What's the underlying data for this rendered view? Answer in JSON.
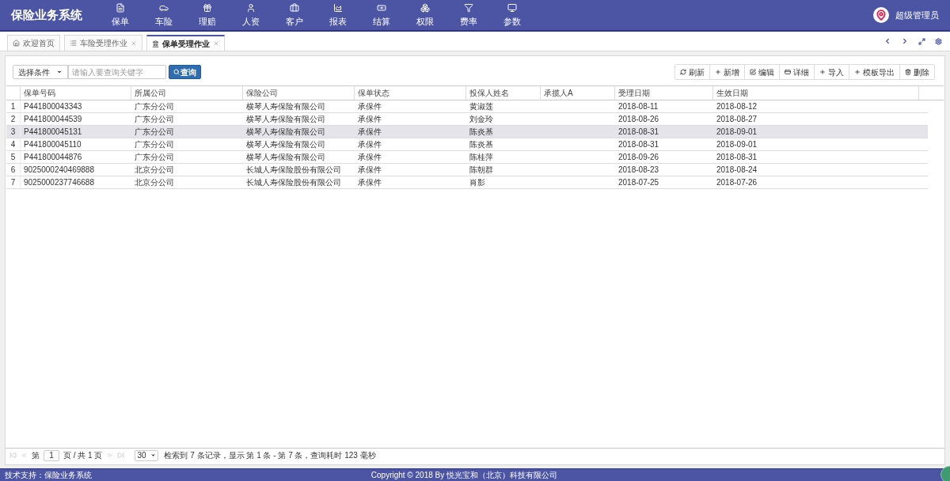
{
  "app_title": "保险业务系统",
  "nav": [
    {
      "label": "保单"
    },
    {
      "label": "车险"
    },
    {
      "label": "理赔"
    },
    {
      "label": "人资"
    },
    {
      "label": "客户"
    },
    {
      "label": "报表"
    },
    {
      "label": "结算"
    },
    {
      "label": "权限"
    },
    {
      "label": "费率"
    },
    {
      "label": "参数"
    }
  ],
  "user": {
    "name": "超级管理员"
  },
  "tabs": [
    {
      "label": "欢迎首页",
      "closable": false,
      "selected": false
    },
    {
      "label": "车险受理作业",
      "closable": true,
      "selected": false
    },
    {
      "label": "保单受理作业",
      "closable": true,
      "selected": true
    }
  ],
  "search": {
    "condition": "选择条件",
    "placeholder": "请输入要查询关键字",
    "button": "查询"
  },
  "actions": [
    {
      "label": "刷新"
    },
    {
      "label": "新增"
    },
    {
      "label": "编辑"
    },
    {
      "label": "详细"
    },
    {
      "label": "导入"
    },
    {
      "label": "模板导出"
    },
    {
      "label": "删除"
    }
  ],
  "table": {
    "columns": [
      "保单号码",
      "所属公司",
      "保险公司",
      "保单状态",
      "投保人姓名",
      "承揽人A",
      "受理日期",
      "生效日期"
    ],
    "rows": [
      {
        "index": "1",
        "cells": [
          "P441800043343",
          "广东分公司",
          "横琴人寿保险有限公司",
          "承保件",
          "黄淑莲",
          "",
          "2018-08-11",
          "2018-08-12"
        ],
        "selected": false
      },
      {
        "index": "2",
        "cells": [
          "P441800044539",
          "广东分公司",
          "横琴人寿保险有限公司",
          "承保件",
          "刘金玲",
          "",
          "2018-08-26",
          "2018-08-27"
        ],
        "selected": false
      },
      {
        "index": "3",
        "cells": [
          "P441800045131",
          "广东分公司",
          "横琴人寿保险有限公司",
          "承保件",
          "陈炎基",
          "",
          "2018-08-31",
          "2018-09-01"
        ],
        "selected": true
      },
      {
        "index": "4",
        "cells": [
          "P441800045110",
          "广东分公司",
          "横琴人寿保险有限公司",
          "承保件",
          "陈炎基",
          "",
          "2018-08-31",
          "2018-09-01"
        ],
        "selected": false
      },
      {
        "index": "5",
        "cells": [
          "P441800044876",
          "广东分公司",
          "横琴人寿保险有限公司",
          "承保件",
          "陈桂萍",
          "",
          "2018-09-26",
          "2018-08-31"
        ],
        "selected": false
      },
      {
        "index": "6",
        "cells": [
          "9025000240469888",
          "北京分公司",
          "长城人寿保险股份有限公司",
          "承保件",
          "陈朝群",
          "",
          "2018-08-23",
          "2018-08-24"
        ],
        "selected": false
      },
      {
        "index": "7",
        "cells": [
          "9025000237746688",
          "北京分公司",
          "长城人寿保险股份有限公司",
          "承保件",
          "肖影",
          "",
          "2018-07-25",
          "2018-07-26"
        ],
        "selected": false
      }
    ]
  },
  "pager": {
    "page_label": "第",
    "page": "1",
    "total": "页 / 共 1 页",
    "page_size": "30",
    "info": "检索到 7 条记录，显示 第 1 条 - 第 7 条，查询耗时 123 毫秒"
  },
  "footer": {
    "left": "技术支持：保险业务系统",
    "right": "Copyright © 2018 By 悦光宝和（北京）科技有限公司"
  }
}
